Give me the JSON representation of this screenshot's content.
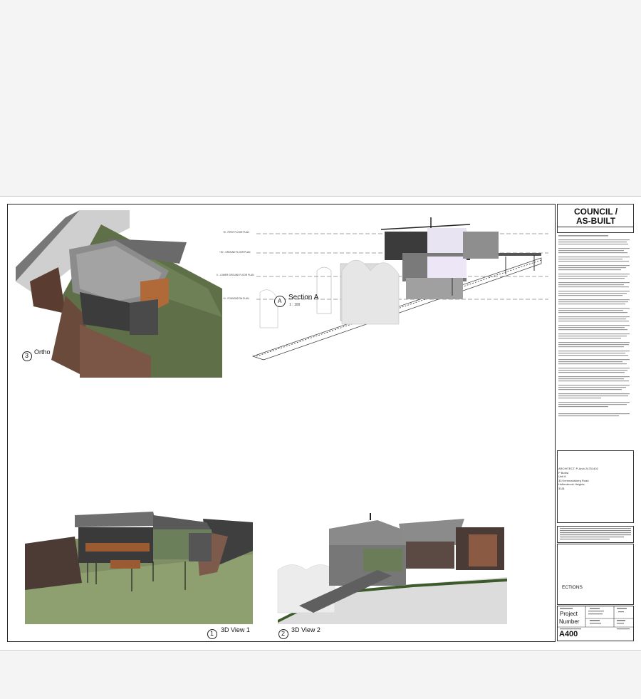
{
  "title_block": {
    "stage_line1": "COUNCIL /",
    "stage_line2": "AS-BUILT",
    "architect_block": "ARCHITECT: P-Arch 24751402\nP Botha\nUnit 8\n33 Kernmansberg Road\nHuttenbrook Heights\n3181",
    "sections_label": "ECTIONS",
    "project_label": "Project",
    "number_label": "Number",
    "drawing_number": "A400"
  },
  "views": {
    "ortho": {
      "number": "3",
      "label": "Ortho"
    },
    "view1": {
      "number": "1",
      "label": "3D View 1"
    },
    "view2": {
      "number": "2",
      "label": "3D View 2"
    },
    "section": {
      "marker": "A",
      "title": "Section A",
      "scale": "1 : 100"
    }
  },
  "levels": [
    {
      "name": "+8 - FIRST FLOOR PLAN"
    },
    {
      "name": "+00 - GROUND FLOOR PLAN"
    },
    {
      "name": "0 - LOWER GROUND FLOOR PLAN"
    },
    {
      "name": "+0 - FOUNDATION PLAN"
    }
  ]
}
